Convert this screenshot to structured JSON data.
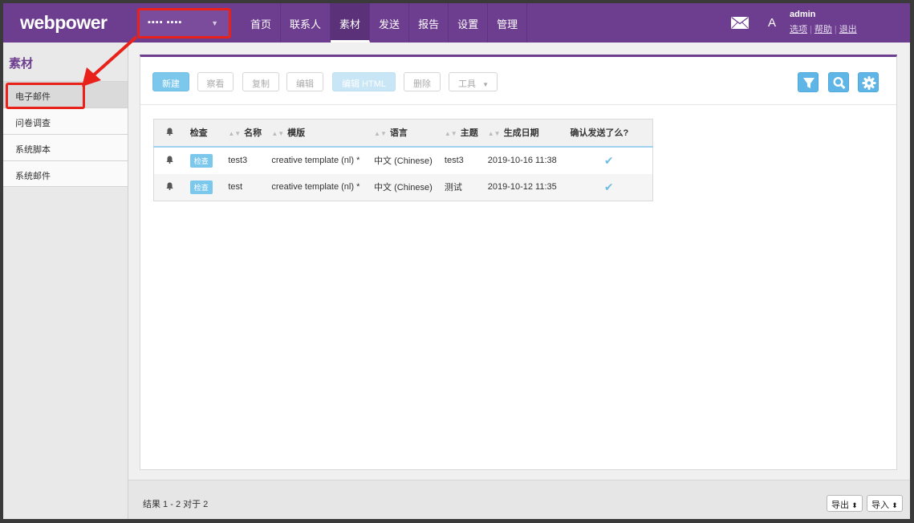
{
  "logo": "webpower",
  "account": {
    "label": "▪▪▪▪ ▪▪▪▪"
  },
  "nav": [
    {
      "label": "首页",
      "active": false
    },
    {
      "label": "联系人",
      "active": false
    },
    {
      "label": "素材",
      "active": true
    },
    {
      "label": "发送",
      "active": false
    },
    {
      "label": "报告",
      "active": false
    },
    {
      "label": "设置",
      "active": false
    },
    {
      "label": "管理",
      "active": false
    }
  ],
  "user": {
    "font_toggle": "A",
    "name": "admin",
    "options": "选项",
    "help": "帮助",
    "logout": "退出"
  },
  "sidebar": {
    "title": "素材",
    "items": [
      {
        "label": "电子邮件",
        "active": true
      },
      {
        "label": "问卷调查",
        "active": false
      },
      {
        "label": "系统脚本",
        "active": false
      },
      {
        "label": "系统邮件",
        "active": false
      }
    ]
  },
  "toolbar": {
    "new": "新建",
    "view": "察看",
    "copy": "复制",
    "edit": "编辑",
    "edit_html": "编辑 HTML",
    "delete": "删除",
    "tools": "工具"
  },
  "table": {
    "headers": {
      "check": "检查",
      "name": "名称",
      "template": "模版",
      "language": "语言",
      "subject": "主题",
      "created": "生成日期",
      "confirmed": "确认发送了么?"
    },
    "rows": [
      {
        "check": "检查",
        "name": "test3",
        "template": "creative template (nl) *",
        "language": "中文 (Chinese)",
        "subject": "test3",
        "created": "2019-10-16 11:38"
      },
      {
        "check": "检查",
        "name": "test",
        "template": "creative template (nl) *",
        "language": "中文 (Chinese)",
        "subject": "测试",
        "created": "2019-10-12 11:35"
      }
    ]
  },
  "footer": {
    "results": "结果 1 - 2 对于 2",
    "export": "导出",
    "import": "导入"
  },
  "colors": {
    "brand": "#6d3e8f",
    "accent": "#7cc8ec",
    "highlight": "#e8221b"
  }
}
